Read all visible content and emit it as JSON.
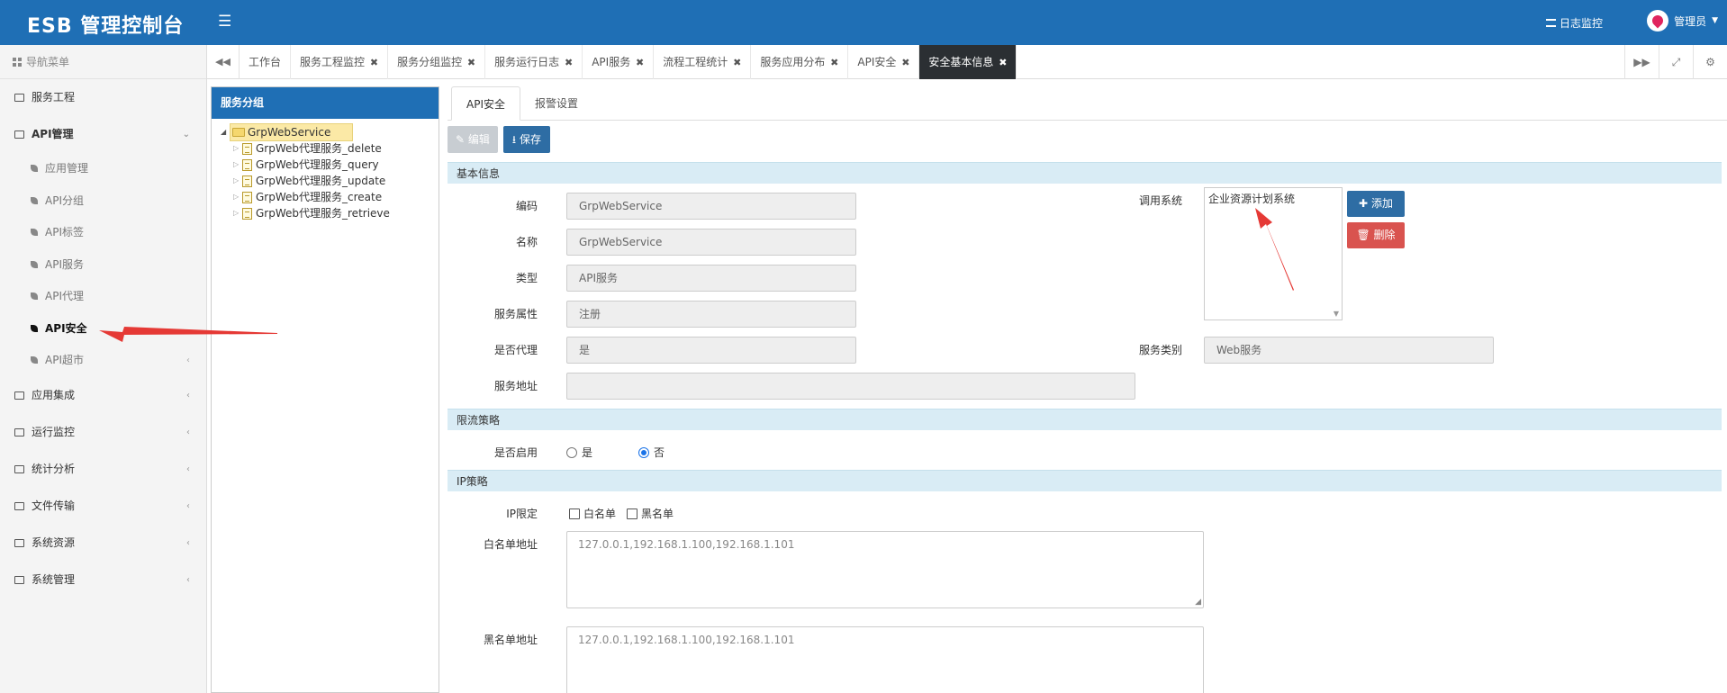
{
  "header": {
    "brand": "ESB 管理控制台",
    "log_monitor": "日志监控",
    "user": "管理员"
  },
  "sidebar": {
    "title": "导航菜单",
    "items": [
      {
        "label": "服务工程"
      },
      {
        "label": "API管理"
      },
      {
        "label": "应用集成"
      },
      {
        "label": "运行监控"
      },
      {
        "label": "统计分析"
      },
      {
        "label": "文件传输"
      },
      {
        "label": "系统资源"
      },
      {
        "label": "系统管理"
      }
    ],
    "api_sub": [
      "应用管理",
      "API分组",
      "API标签",
      "API服务",
      "API代理",
      "API安全",
      "API超市"
    ]
  },
  "tabs": [
    {
      "label": "工作台"
    },
    {
      "label": "服务工程监控"
    },
    {
      "label": "服务分组监控"
    },
    {
      "label": "服务运行日志"
    },
    {
      "label": "API服务"
    },
    {
      "label": "流程工程统计"
    },
    {
      "label": "服务应用分布"
    },
    {
      "label": "API安全"
    },
    {
      "label": "安全基本信息"
    }
  ],
  "tree": {
    "title": "服务分组",
    "root": "GrpWebService",
    "children": [
      "GrpWeb代理服务_delete",
      "GrpWeb代理服务_query",
      "GrpWeb代理服务_update",
      "GrpWeb代理服务_create",
      "GrpWeb代理服务_retrieve"
    ]
  },
  "subtabs": [
    "API安全",
    "报警设置"
  ],
  "toolbar": {
    "edit": "编辑",
    "save": "保存"
  },
  "sections": {
    "basic": "基本信息",
    "limit": "限流策略",
    "ip": "IP策略"
  },
  "form": {
    "code_label": "编码",
    "code_value": "GrpWebService",
    "name_label": "名称",
    "name_value": "GrpWebService",
    "type_label": "类型",
    "type_value": "API服务",
    "attr_label": "服务属性",
    "attr_value": "注册",
    "proxy_label": "是否代理",
    "proxy_value": "是",
    "addr_label": "服务地址",
    "addr_value": "",
    "caller_label": "调用系统",
    "caller_items": [
      "企业资源计划系统"
    ],
    "add_btn": "添加",
    "del_btn": "删除",
    "category_label": "服务类别",
    "category_value": "Web服务",
    "enable_label": "是否启用",
    "enable_yes": "是",
    "enable_no": "否",
    "ip_limit_label": "IP限定",
    "whitelist_opt": "白名单",
    "blacklist_opt": "黑名单",
    "whitelist_label": "白名单地址",
    "whitelist_value": "127.0.0.1,192.168.1.100,192.168.1.101",
    "blacklist_label": "黑名单地址",
    "blacklist_value": "127.0.0.1,192.168.1.100,192.168.1.101"
  },
  "colors": {
    "header": "#1f6fb5",
    "section": "#d9ecf5",
    "save": "#2e6da4",
    "delete": "#d9534f",
    "arrow": "#e53935"
  }
}
